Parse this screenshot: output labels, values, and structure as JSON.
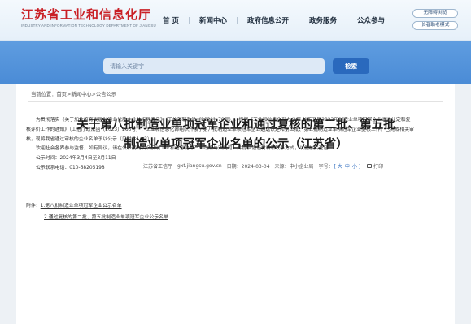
{
  "header": {
    "site_title": "江苏省工业和信息化厅",
    "site_subtitle": "INDUSTRY AND INFORMATION TECHNOLOGY DEPARTMENT OF JIANGSU",
    "nav": [
      "首 页",
      "新闻中心",
      "政府信息公开",
      "政务服务",
      "公众参与"
    ],
    "accessibility": [
      "无障碍浏览",
      "长者助老模式"
    ],
    "brand_color": "#c91f25"
  },
  "search": {
    "placeholder": "请输入关键字",
    "button_label": "检索",
    "accent_color": "#2a69bd"
  },
  "breadcrumb": {
    "label": "当前位置：",
    "home": "首页",
    "path": ">新闻中心>公告公示"
  },
  "article": {
    "title_line1": "关于第八批制造业单项冠军企业和通过复核的第二批、第五批",
    "title_line2": "制造业单项冠军企业名单的公示（江苏省）",
    "meta": {
      "source": "江苏省工信厅",
      "domain": "gxt.jiangsu.gov.cn",
      "date": "日期：2024-03-04",
      "origin": "来源：中小企业局",
      "font_label": "字号：",
      "font_large": "[ 大",
      "font_medium": "中",
      "font_small": "小 ]",
      "print_label": "打印"
    },
    "paragraph1": "为贯彻落实《关于加快培育发展制造业优质企业的指导意见》（工信部联政法〔2021〕70号），根据《工业和信息化部办公厅 关于开展2023年制造业单项冠军企业遴选认定和复核评价工作的通知》（工信厅政法函〔2023〕263号），工业和信息化部组织开展了第八批制造业单项冠军企业遴选认定和第二批、第五批制造业单项冠军企业复核工作。已完成相关审核，现将我省通过审核的企业名单予以公示（见附件1、2）。",
    "paragraph2": "欢迎社会各界参与监督，如有异议，请在公示期内实名反映工业和信息化部产业政策与法规司，并提供佐证材料和联系方式，以便核实查证。",
    "period": "公示时间：2024年3月4日至3月11日",
    "contact": "公示联系电话：010-68205198",
    "attachments_label": "附件：",
    "attachments": [
      "1.第八批制造业单项冠军企业公示名单",
      "2.通过复核的第二批、第五批制造业单项冠军企业公示名单"
    ]
  }
}
